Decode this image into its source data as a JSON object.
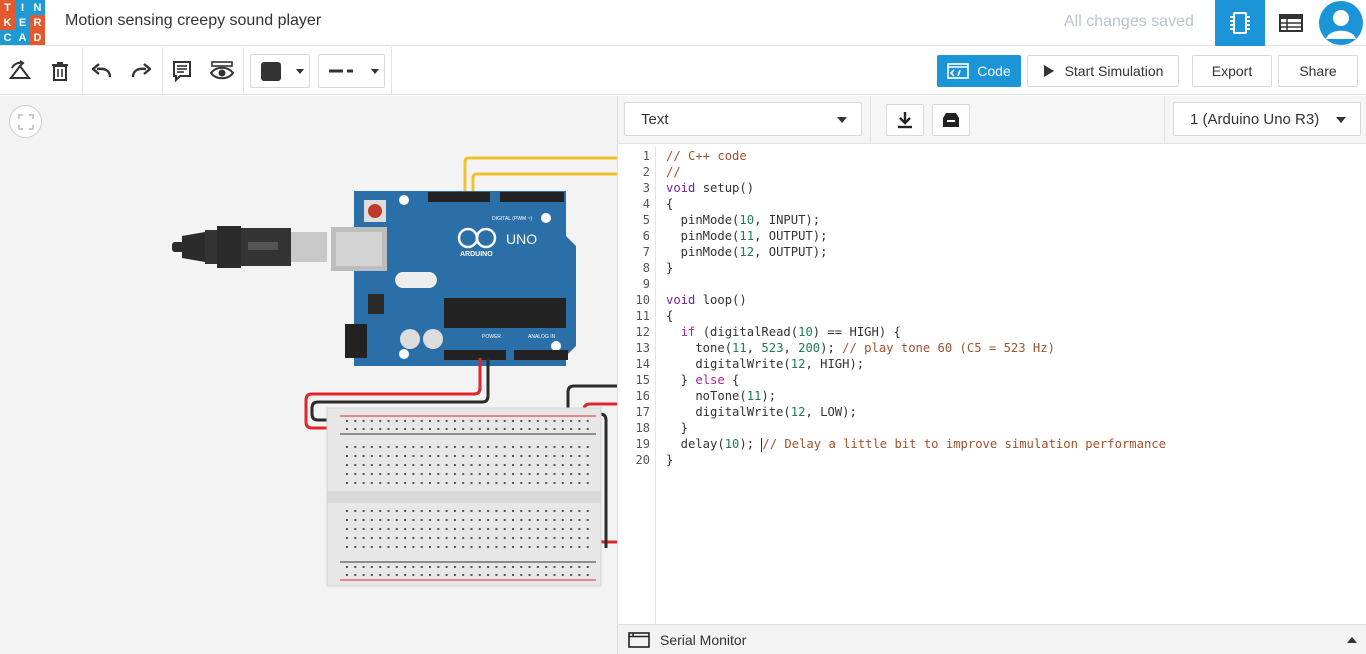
{
  "header": {
    "logo_letters": [
      "T",
      "I",
      "N",
      "K",
      "E",
      "R",
      "C",
      "A",
      "D"
    ],
    "logo_colors": [
      "#e3582d",
      "#1d9bd6",
      "#1d9bd6",
      "#e3582d",
      "#1d9bd6",
      "#e3582d",
      "#1d9bd6",
      "#1d9bd6",
      "#e3582d"
    ],
    "project_title": "Motion sensing creepy sound player",
    "save_status": "All changes saved",
    "accent": "#1b95d8"
  },
  "toolbar": {
    "code_label": "Code",
    "start_simulation_label": "Start Simulation",
    "export_label": "Export",
    "share_label": "Share",
    "fill_color": "#333333"
  },
  "code_panel": {
    "mode_select": "Text",
    "board_select": "1 (Arduino Uno R3)",
    "line_numbers": [
      "1",
      "2",
      "3",
      "4",
      "5",
      "6",
      "7",
      "8",
      "9",
      "10",
      "11",
      "12",
      "13",
      "14",
      "15",
      "16",
      "17",
      "18",
      "19",
      "20"
    ],
    "serial_monitor_label": "Serial Monitor",
    "code": {
      "l1": "// C++ code",
      "l2": "//",
      "l3_kw": "void",
      "l3_rest": " setup()",
      "l4": "{",
      "l5_a": "  pinMode(",
      "l5_n": "10",
      "l5_b": ", INPUT);",
      "l6_a": "  pinMode(",
      "l6_n": "11",
      "l6_b": ", OUTPUT);",
      "l7_a": "  pinMode(",
      "l7_n": "12",
      "l7_b": ", OUTPUT);",
      "l8": "}",
      "l9": "",
      "l10_kw": "void",
      "l10_rest": " loop()",
      "l11": "{",
      "l12_pre": "  ",
      "l12_kw": "if",
      "l12_a": " (digitalRead(",
      "l12_n": "10",
      "l12_b": ") == HIGH) {",
      "l13_a": "    tone(",
      "l13_n1": "11",
      "l13_s1": ", ",
      "l13_n2": "523",
      "l13_s2": ", ",
      "l13_n3": "200",
      "l13_s3": "); ",
      "l13_c": "// play tone 60 (C5 = 523 Hz)",
      "l14_a": "    digitalWrite(",
      "l14_n": "12",
      "l14_b": ", HIGH);",
      "l15_a": "  } ",
      "l15_kw": "else",
      "l15_b": " {",
      "l16_a": "    noTone(",
      "l16_n": "11",
      "l16_b": ");",
      "l17_a": "    digitalWrite(",
      "l17_n": "12",
      "l17_b": ", LOW);",
      "l18": "  }",
      "l19_a": "  delay(",
      "l19_n": "10",
      "l19_b": "); ",
      "l19_c": "// Delay a little bit to improve simulation performance",
      "l20": "}"
    }
  },
  "canvas": {
    "board_label": "UNO",
    "board_sub": "ARDUINO",
    "digital_label": "DIGITAL (PWM ~)",
    "power_label": "POWER",
    "analog_label": "ANALOG IN",
    "board_color": "#2a6fa8",
    "wire_yellow": "#f2c12e",
    "wire_red": "#e0262b",
    "wire_black": "#2b2b2b"
  }
}
